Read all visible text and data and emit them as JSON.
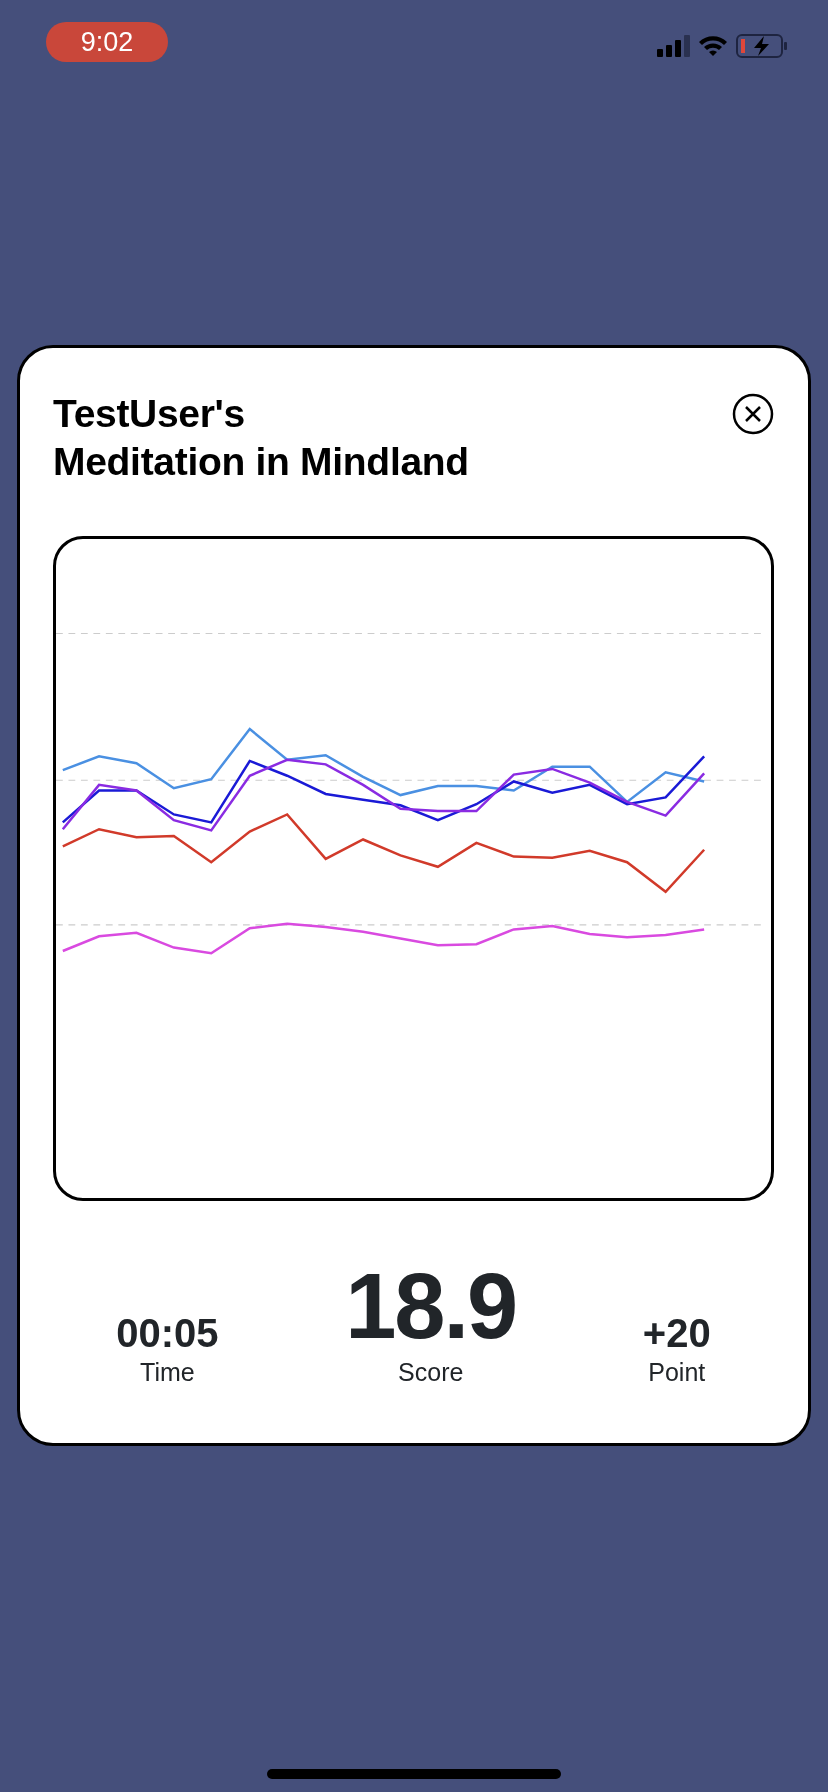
{
  "status_bar": {
    "time": "9:02"
  },
  "card": {
    "title_line_1": "TestUser's",
    "title_line_2": "Meditation in Mindland",
    "stats": [
      {
        "kind": "small",
        "value": "00:05",
        "label": "Time"
      },
      {
        "kind": "large",
        "value": "18.9",
        "label": "Score"
      },
      {
        "kind": "small",
        "value": "+20",
        "label": "Point"
      }
    ]
  }
}
